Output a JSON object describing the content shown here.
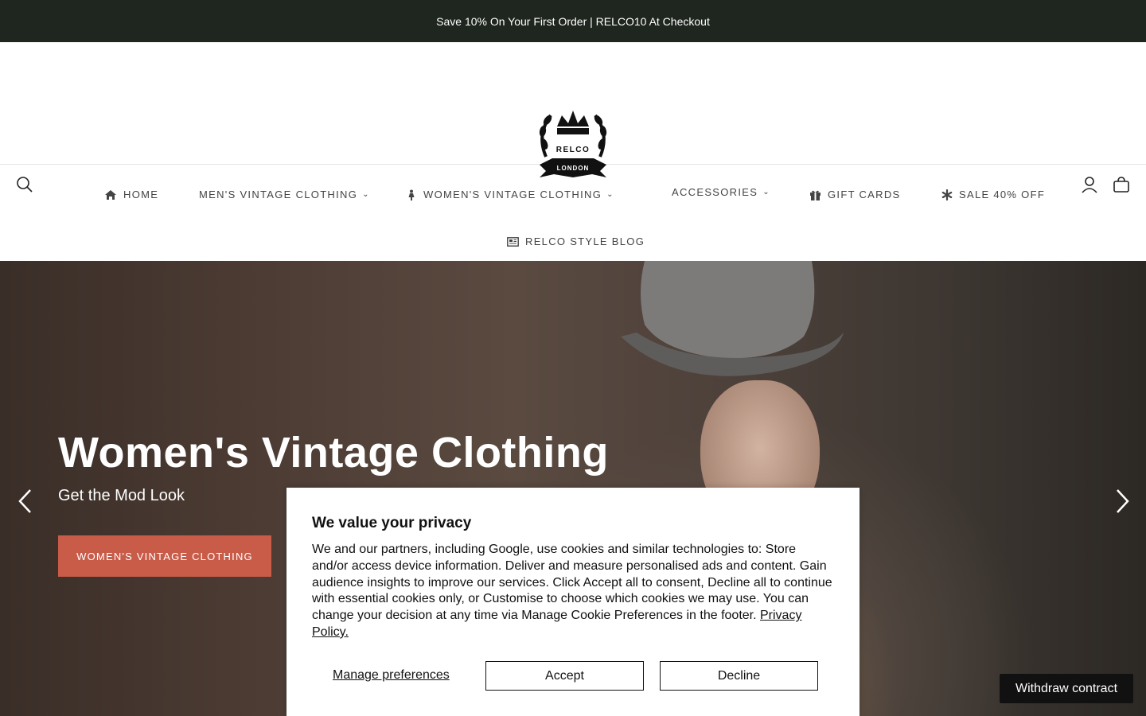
{
  "announcement": "Save 10% On Your First Order | RELCO10 At Checkout",
  "logo": {
    "line1": "RELCO",
    "line2": "LONDON"
  },
  "header_icons": [
    "search-icon",
    "account-icon",
    "cart-icon"
  ],
  "nav": {
    "home": "HOME",
    "mens": "MEN'S VINTAGE CLOTHING",
    "womens": "WOMEN'S VINTAGE CLOTHING",
    "accessories": "ACCESSORIES",
    "gift_cards": "GIFT CARDS",
    "sale": "SALE 40% OFF",
    "blog": "RELCO STYLE BLOG",
    "chevron": "⌄"
  },
  "hero": {
    "title": "Women's Vintage Clothing",
    "subtitle": "Get the Mod Look",
    "button": "WOMEN'S VINTAGE CLOTHING"
  },
  "cookie": {
    "title": "We value your privacy",
    "body": "We and our partners, including Google, use cookies and similar technologies to: Store and/or access device information. Deliver and measure personalised ads and content. Gain audience insights to improve our services. Click Accept all to consent, Decline all to continue with essential cookies only, or Customise to choose which cookies we may use. You can change your decision at any time via Manage Cookie Preferences in the footer. ",
    "policy_link": "Privacy Policy.",
    "manage": "Manage preferences",
    "accept": "Accept",
    "decline": "Decline"
  },
  "withdraw": "Withdraw contract",
  "colors": {
    "announcement_bg": "#1f251f",
    "hero_button": "#c95b49"
  }
}
